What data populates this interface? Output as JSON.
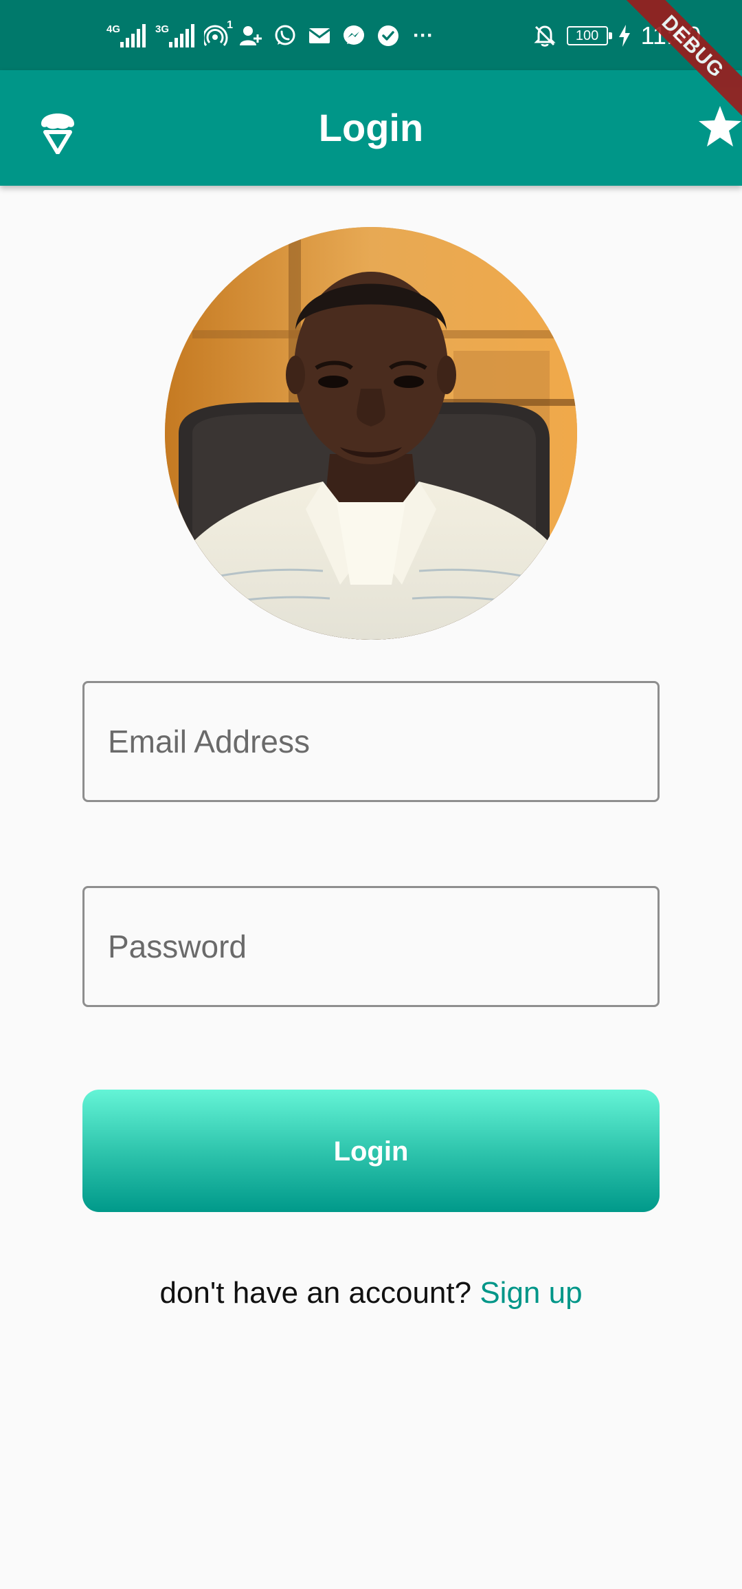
{
  "status_bar": {
    "signal_1_tag": "4G",
    "signal_2_tag": "3G",
    "hotspot_count": "1",
    "more": "···",
    "battery": "100",
    "time": "11:40"
  },
  "debug_banner": "DEBUG",
  "app_bar": {
    "title": "Login",
    "leading_icon": "ice-cream-icon",
    "action_icon": "star-icon"
  },
  "form": {
    "email_placeholder": "Email Address",
    "email_value": "",
    "password_placeholder": "Password",
    "password_value": "",
    "login_label": "Login"
  },
  "signup": {
    "prompt": "don't have an account?",
    "link": "Sign up"
  },
  "colors": {
    "status_bar": "#00796b",
    "app_bar": "#009688",
    "button_top": "#64f4d6",
    "button_bottom": "#00998a",
    "link": "#009688",
    "background": "#fafafa"
  }
}
